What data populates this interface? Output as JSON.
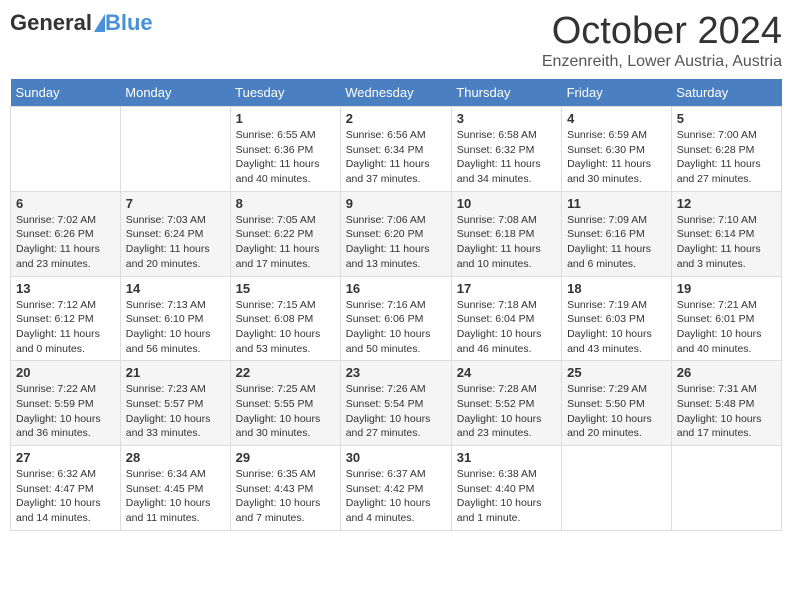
{
  "header": {
    "logo_general": "General",
    "logo_blue": "Blue",
    "month": "October 2024",
    "location": "Enzenreith, Lower Austria, Austria"
  },
  "weekdays": [
    "Sunday",
    "Monday",
    "Tuesday",
    "Wednesday",
    "Thursday",
    "Friday",
    "Saturday"
  ],
  "weeks": [
    [
      {
        "day": "",
        "sunrise": "",
        "sunset": "",
        "daylight": ""
      },
      {
        "day": "",
        "sunrise": "",
        "sunset": "",
        "daylight": ""
      },
      {
        "day": "1",
        "sunrise": "Sunrise: 6:55 AM",
        "sunset": "Sunset: 6:36 PM",
        "daylight": "Daylight: 11 hours and 40 minutes."
      },
      {
        "day": "2",
        "sunrise": "Sunrise: 6:56 AM",
        "sunset": "Sunset: 6:34 PM",
        "daylight": "Daylight: 11 hours and 37 minutes."
      },
      {
        "day": "3",
        "sunrise": "Sunrise: 6:58 AM",
        "sunset": "Sunset: 6:32 PM",
        "daylight": "Daylight: 11 hours and 34 minutes."
      },
      {
        "day": "4",
        "sunrise": "Sunrise: 6:59 AM",
        "sunset": "Sunset: 6:30 PM",
        "daylight": "Daylight: 11 hours and 30 minutes."
      },
      {
        "day": "5",
        "sunrise": "Sunrise: 7:00 AM",
        "sunset": "Sunset: 6:28 PM",
        "daylight": "Daylight: 11 hours and 27 minutes."
      }
    ],
    [
      {
        "day": "6",
        "sunrise": "Sunrise: 7:02 AM",
        "sunset": "Sunset: 6:26 PM",
        "daylight": "Daylight: 11 hours and 23 minutes."
      },
      {
        "day": "7",
        "sunrise": "Sunrise: 7:03 AM",
        "sunset": "Sunset: 6:24 PM",
        "daylight": "Daylight: 11 hours and 20 minutes."
      },
      {
        "day": "8",
        "sunrise": "Sunrise: 7:05 AM",
        "sunset": "Sunset: 6:22 PM",
        "daylight": "Daylight: 11 hours and 17 minutes."
      },
      {
        "day": "9",
        "sunrise": "Sunrise: 7:06 AM",
        "sunset": "Sunset: 6:20 PM",
        "daylight": "Daylight: 11 hours and 13 minutes."
      },
      {
        "day": "10",
        "sunrise": "Sunrise: 7:08 AM",
        "sunset": "Sunset: 6:18 PM",
        "daylight": "Daylight: 11 hours and 10 minutes."
      },
      {
        "day": "11",
        "sunrise": "Sunrise: 7:09 AM",
        "sunset": "Sunset: 6:16 PM",
        "daylight": "Daylight: 11 hours and 6 minutes."
      },
      {
        "day": "12",
        "sunrise": "Sunrise: 7:10 AM",
        "sunset": "Sunset: 6:14 PM",
        "daylight": "Daylight: 11 hours and 3 minutes."
      }
    ],
    [
      {
        "day": "13",
        "sunrise": "Sunrise: 7:12 AM",
        "sunset": "Sunset: 6:12 PM",
        "daylight": "Daylight: 11 hours and 0 minutes."
      },
      {
        "day": "14",
        "sunrise": "Sunrise: 7:13 AM",
        "sunset": "Sunset: 6:10 PM",
        "daylight": "Daylight: 10 hours and 56 minutes."
      },
      {
        "day": "15",
        "sunrise": "Sunrise: 7:15 AM",
        "sunset": "Sunset: 6:08 PM",
        "daylight": "Daylight: 10 hours and 53 minutes."
      },
      {
        "day": "16",
        "sunrise": "Sunrise: 7:16 AM",
        "sunset": "Sunset: 6:06 PM",
        "daylight": "Daylight: 10 hours and 50 minutes."
      },
      {
        "day": "17",
        "sunrise": "Sunrise: 7:18 AM",
        "sunset": "Sunset: 6:04 PM",
        "daylight": "Daylight: 10 hours and 46 minutes."
      },
      {
        "day": "18",
        "sunrise": "Sunrise: 7:19 AM",
        "sunset": "Sunset: 6:03 PM",
        "daylight": "Daylight: 10 hours and 43 minutes."
      },
      {
        "day": "19",
        "sunrise": "Sunrise: 7:21 AM",
        "sunset": "Sunset: 6:01 PM",
        "daylight": "Daylight: 10 hours and 40 minutes."
      }
    ],
    [
      {
        "day": "20",
        "sunrise": "Sunrise: 7:22 AM",
        "sunset": "Sunset: 5:59 PM",
        "daylight": "Daylight: 10 hours and 36 minutes."
      },
      {
        "day": "21",
        "sunrise": "Sunrise: 7:23 AM",
        "sunset": "Sunset: 5:57 PM",
        "daylight": "Daylight: 10 hours and 33 minutes."
      },
      {
        "day": "22",
        "sunrise": "Sunrise: 7:25 AM",
        "sunset": "Sunset: 5:55 PM",
        "daylight": "Daylight: 10 hours and 30 minutes."
      },
      {
        "day": "23",
        "sunrise": "Sunrise: 7:26 AM",
        "sunset": "Sunset: 5:54 PM",
        "daylight": "Daylight: 10 hours and 27 minutes."
      },
      {
        "day": "24",
        "sunrise": "Sunrise: 7:28 AM",
        "sunset": "Sunset: 5:52 PM",
        "daylight": "Daylight: 10 hours and 23 minutes."
      },
      {
        "day": "25",
        "sunrise": "Sunrise: 7:29 AM",
        "sunset": "Sunset: 5:50 PM",
        "daylight": "Daylight: 10 hours and 20 minutes."
      },
      {
        "day": "26",
        "sunrise": "Sunrise: 7:31 AM",
        "sunset": "Sunset: 5:48 PM",
        "daylight": "Daylight: 10 hours and 17 minutes."
      }
    ],
    [
      {
        "day": "27",
        "sunrise": "Sunrise: 6:32 AM",
        "sunset": "Sunset: 4:47 PM",
        "daylight": "Daylight: 10 hours and 14 minutes."
      },
      {
        "day": "28",
        "sunrise": "Sunrise: 6:34 AM",
        "sunset": "Sunset: 4:45 PM",
        "daylight": "Daylight: 10 hours and 11 minutes."
      },
      {
        "day": "29",
        "sunrise": "Sunrise: 6:35 AM",
        "sunset": "Sunset: 4:43 PM",
        "daylight": "Daylight: 10 hours and 7 minutes."
      },
      {
        "day": "30",
        "sunrise": "Sunrise: 6:37 AM",
        "sunset": "Sunset: 4:42 PM",
        "daylight": "Daylight: 10 hours and 4 minutes."
      },
      {
        "day": "31",
        "sunrise": "Sunrise: 6:38 AM",
        "sunset": "Sunset: 4:40 PM",
        "daylight": "Daylight: 10 hours and 1 minute."
      },
      {
        "day": "",
        "sunrise": "",
        "sunset": "",
        "daylight": ""
      },
      {
        "day": "",
        "sunrise": "",
        "sunset": "",
        "daylight": ""
      }
    ]
  ]
}
